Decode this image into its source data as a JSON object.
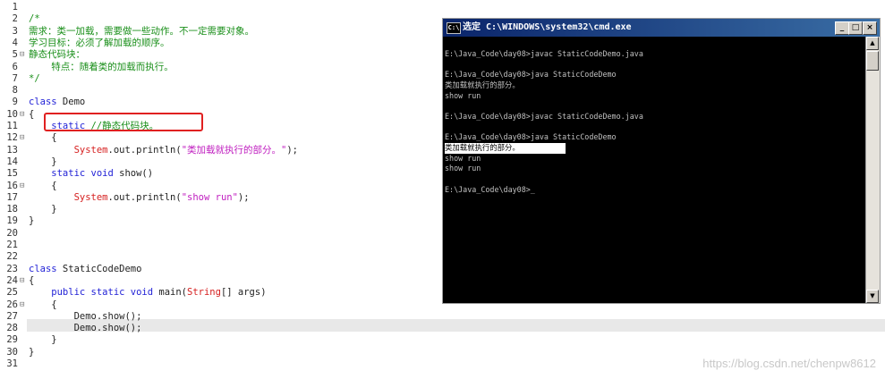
{
  "editor": {
    "line_numbers": [
      "1",
      "2",
      "3",
      "4",
      "5",
      "6",
      "7",
      "8",
      "9",
      "10",
      "11",
      "12",
      "13",
      "14",
      "15",
      "16",
      "17",
      "18",
      "19",
      "20",
      "21",
      "22",
      "23",
      "24",
      "25",
      "26",
      "27",
      "28",
      "29",
      "30",
      "31"
    ],
    "fold_markers": [
      "",
      "",
      "",
      "",
      "⊟",
      "",
      "",
      "",
      "",
      "⊟",
      "",
      "⊟",
      "",
      "",
      "",
      "⊟",
      "",
      "",
      "",
      "",
      "",
      "",
      "",
      "⊟",
      "",
      "⊟",
      "",
      "",
      "",
      "",
      ""
    ],
    "lines": [
      [],
      [
        {
          "t": "/*",
          "c": "cm"
        }
      ],
      [
        {
          "t": "需求：类一加载，需要做一些动作。不一定需要对象。",
          "c": "cm"
        }
      ],
      [
        {
          "t": "学习目标：必须了解加载的顺序。",
          "c": "cm"
        }
      ],
      [
        {
          "t": "静态代码块：",
          "c": "cm"
        }
      ],
      [
        {
          "t": "    特点：随着类的加载而执行。",
          "c": "cm"
        }
      ],
      [
        {
          "t": "*/",
          "c": "cm"
        }
      ],
      [],
      [
        {
          "t": "class",
          "c": "kw"
        },
        {
          "t": " Demo",
          "c": "pl"
        }
      ],
      [
        {
          "t": "{",
          "c": "pl"
        }
      ],
      [
        {
          "t": "    static",
          "c": "kw"
        },
        {
          "t": " //静态代码块。",
          "c": "cm"
        }
      ],
      [
        {
          "t": "    {",
          "c": "pl"
        }
      ],
      [
        {
          "t": "        System",
          "c": "ty"
        },
        {
          "t": ".out.println(",
          "c": "pl"
        },
        {
          "t": "\"类加载就执行的部分。\"",
          "c": "str"
        },
        {
          "t": ");",
          "c": "pl"
        }
      ],
      [
        {
          "t": "    }",
          "c": "pl"
        }
      ],
      [
        {
          "t": "    static void",
          "c": "kw"
        },
        {
          "t": " show()",
          "c": "pl"
        }
      ],
      [
        {
          "t": "    {",
          "c": "pl"
        }
      ],
      [
        {
          "t": "        System",
          "c": "ty"
        },
        {
          "t": ".out.println(",
          "c": "pl"
        },
        {
          "t": "\"show run\"",
          "c": "str"
        },
        {
          "t": ");",
          "c": "pl"
        }
      ],
      [
        {
          "t": "    }",
          "c": "pl"
        }
      ],
      [
        {
          "t": "}",
          "c": "pl"
        }
      ],
      [],
      [],
      [],
      [
        {
          "t": "class",
          "c": "kw"
        },
        {
          "t": " StaticCodeDemo",
          "c": "pl"
        }
      ],
      [
        {
          "t": "{",
          "c": "pl"
        }
      ],
      [
        {
          "t": "    public static void",
          "c": "kw"
        },
        {
          "t": " main(",
          "c": "pl"
        },
        {
          "t": "String",
          "c": "ty"
        },
        {
          "t": "[] args)",
          "c": "pl"
        }
      ],
      [
        {
          "t": "    {",
          "c": "pl"
        }
      ],
      [
        {
          "t": "        Demo.show();",
          "c": "pl"
        }
      ],
      [
        {
          "t": "        Demo.show();",
          "c": "pl"
        }
      ],
      [
        {
          "t": "    }",
          "c": "pl"
        }
      ],
      [
        {
          "t": "}",
          "c": "pl"
        }
      ],
      []
    ]
  },
  "cmd": {
    "icon_text": "C:\\",
    "title": "选定 C:\\WINDOWS\\system32\\cmd.exe",
    "minimize_label": "_",
    "maximize_label": "□",
    "close_label": "×",
    "scroll_up_label": "▲",
    "scroll_down_label": "▼",
    "lines": [
      "",
      "E:\\Java_Code\\day08>javac StaticCodeDemo.java",
      "",
      "E:\\Java_Code\\day08>java StaticCodeDemo",
      "类加载就执行的部分。",
      "show run",
      "",
      "E:\\Java_Code\\day08>javac StaticCodeDemo.java",
      "",
      "E:\\Java_Code\\day08>java StaticCodeDemo",
      "类加载就执行的部分。",
      "show run",
      "show run",
      "",
      "E:\\Java_Code\\day08>_"
    ],
    "selected_line_index": 10
  },
  "watermark": "https://blog.csdn.net/chenpw8612"
}
